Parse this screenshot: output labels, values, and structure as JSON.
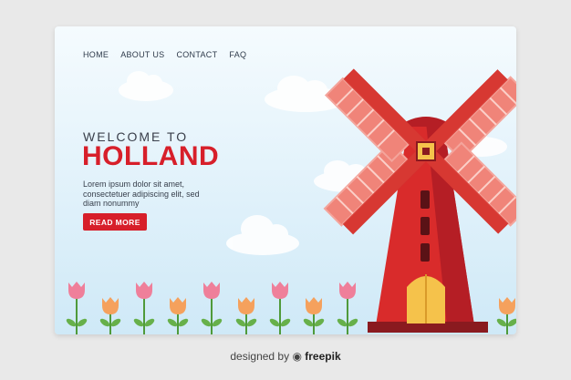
{
  "nav": {
    "items": [
      "HOME",
      "ABOUT US",
      "CONTACT",
      "FAQ"
    ]
  },
  "hero": {
    "welcome": "WELCOME TO",
    "title": "HOLLAND",
    "description": "Lorem ipsum dolor sit amet, consectetuer adipiscing elit, sed diam nonummy",
    "cta_label": "READ MORE"
  },
  "footer": {
    "credit_prefix": "designed by",
    "brand": "freepik"
  },
  "colors": {
    "accent": "#d71f2a",
    "sky": "#e4f3fb",
    "windmill_body": "#d92b2b",
    "sail": "#f08479",
    "door": "#f5c24b",
    "tulip_pink": "#ef7f9a",
    "tulip_orange": "#f5a15d"
  },
  "icons": [
    "windmill-illustration",
    "cloud-shape",
    "tulip-flower",
    "freepik-logo-icon"
  ]
}
